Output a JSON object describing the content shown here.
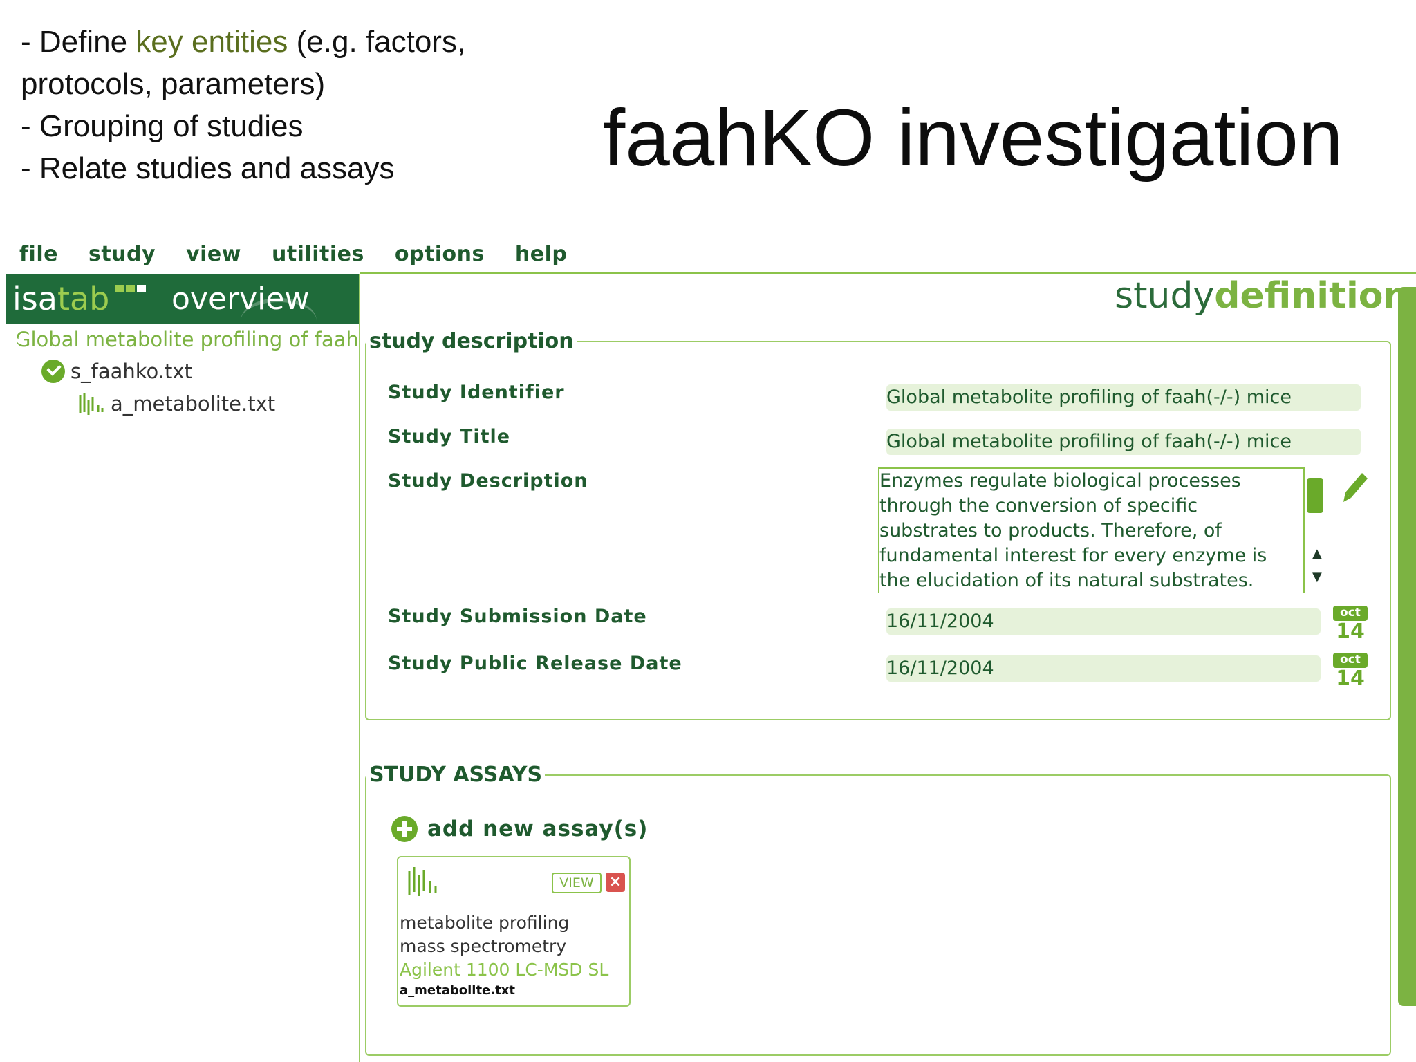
{
  "slide": {
    "bullets": [
      {
        "pre": "-  Define ",
        "highlight": "key entities",
        "post": " (e.g. factors,"
      },
      {
        "pre": "protocols, parameters)",
        "highlight": "",
        "post": ""
      },
      {
        "pre": "- Grouping of studies",
        "highlight": "",
        "post": ""
      },
      {
        "pre": "- Relate studies and assays",
        "highlight": "",
        "post": ""
      }
    ],
    "title": "faahKO investigation"
  },
  "menu": [
    "file",
    "study",
    "view",
    "utilities",
    "options",
    "help"
  ],
  "overview": {
    "logo_main": "isa",
    "logo_tab": "tab",
    "title": "overview",
    "logo_dot_colors": [
      "#9ccc4f",
      "#9ccc4f",
      "#ffffff"
    ]
  },
  "tree": {
    "investigation": "Global metabolite profiling of faah(-/-) mice",
    "study_file": "s_faahko.txt",
    "assay_file": "a_metabolite.txt"
  },
  "study_definition": {
    "title_a": "study",
    "title_b": "definition"
  },
  "study_description": {
    "legend": "study description",
    "fields": {
      "identifier_label": "Study Identifier",
      "identifier_value": "Global metabolite profiling of faah(-/-) mice",
      "title_label": "Study Title",
      "title_value": "Global metabolite profiling of faah(-/-) mice",
      "description_label": "Study Description",
      "description_value": "Enzymes regulate biological processes\nthrough the conversion of specific\nsubstrates to products. Therefore, of\nfundamental interest for every enzyme is\nthe elucidation of its natural substrates.",
      "submission_label": "Study Submission Date",
      "submission_value": "16/11/2004",
      "release_label": "Study Public Release Date",
      "release_value": "16/11/2004"
    },
    "calendar": {
      "month": "oct",
      "day": "14"
    }
  },
  "assays": {
    "legend": "STUDY ASSAYS",
    "add_label": "add new assay(s)",
    "card": {
      "view_label": "VIEW",
      "delete_label": "×",
      "measurement": "metabolite profiling",
      "technology": "mass spectrometry",
      "platform": "Agilent 1100 LC-MSD SL",
      "file": "a_metabolite.txt"
    }
  },
  "colors": {
    "dark_green": "#1f6b3a",
    "accent_green": "#7cb342",
    "field_bg": "#e6f2da"
  }
}
